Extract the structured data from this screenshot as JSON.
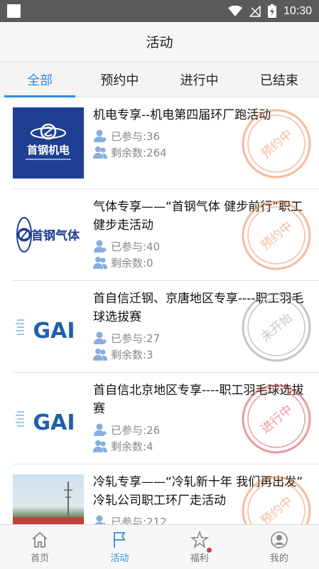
{
  "status_bar": {
    "time": "10:30"
  },
  "header": {
    "title": "活动"
  },
  "tabs": [
    {
      "label": "全部",
      "active": true
    },
    {
      "label": "预约中",
      "active": false
    },
    {
      "label": "进行中",
      "active": false
    },
    {
      "label": "已结束",
      "active": false
    }
  ],
  "activities": [
    {
      "title": "机电专享--机电第四届环厂跑活动",
      "joined": "已参与:36",
      "remaining": "剩余数:264",
      "stamp": "预约中",
      "stamp_color": "#e8793a",
      "logo": "首钢机电"
    },
    {
      "title": "气体专享——“首钢气体 健步前行”职工健步走活动",
      "joined": "已参与:40",
      "remaining": "剩余数:0",
      "stamp": "预约中",
      "stamp_color": "#e8793a",
      "logo": "首钢气体"
    },
    {
      "title": "首自信迁钢、京唐地区专享----职工羽毛球选拔赛",
      "joined": "已参与:27",
      "remaining": "剩余数:3",
      "stamp": "未开始",
      "stamp_color": "#8c8c8c",
      "logo": "GAI"
    },
    {
      "title": "首自信北京地区专享----职工羽毛球选拔赛",
      "joined": "已参与:26",
      "remaining": "剩余数:4",
      "stamp": "进行中",
      "stamp_color": "#d9363e",
      "logo": "GAI"
    },
    {
      "title": "冷轧专享——“冷轧新十年 我们再出发” 冷轧公司职工环厂走活动",
      "joined": "已参与:212",
      "remaining": "",
      "stamp": "预约中",
      "stamp_color": "#e8793a",
      "logo": ""
    }
  ],
  "bottom_nav": [
    {
      "label": "首页",
      "icon": "home-icon",
      "active": false
    },
    {
      "label": "活动",
      "icon": "flag-icon",
      "active": true
    },
    {
      "label": "福利",
      "icon": "star-icon",
      "active": false,
      "badge": true
    },
    {
      "label": "我的",
      "icon": "profile-icon",
      "active": false
    }
  ],
  "colors": {
    "accent": "#2e8ee8",
    "stamp_reserve": "#e8793a",
    "stamp_ongoing": "#d9363e",
    "stamp_pending": "#8c8c8c"
  }
}
